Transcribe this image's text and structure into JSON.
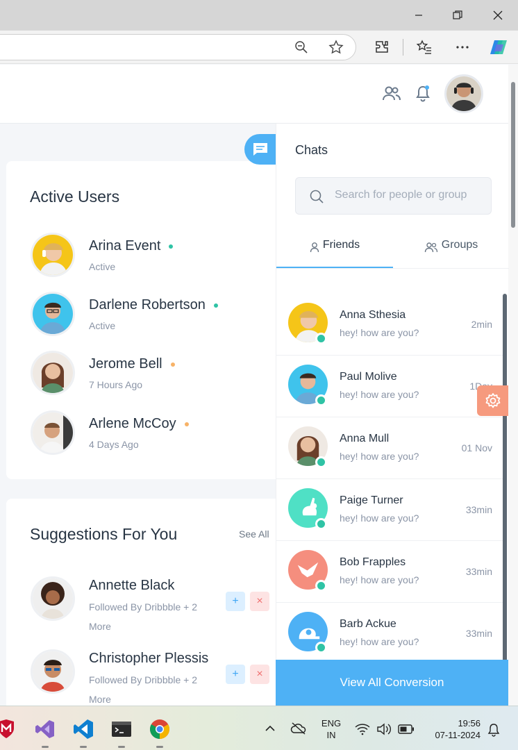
{
  "browser": {
    "window_controls": [
      "minimize",
      "restore",
      "close"
    ]
  },
  "header": {
    "icons": [
      "users-icon",
      "bell-icon"
    ]
  },
  "active_users": {
    "title": "Active Users",
    "users": [
      {
        "name": "Arina Event",
        "status": "Active",
        "dot_color": "#2fc3a5"
      },
      {
        "name": "Darlene Robertson",
        "status": "Active",
        "dot_color": "#2fc3a5"
      },
      {
        "name": "Jerome Bell",
        "status": "7 Hours Ago",
        "dot_color": "#f7b267"
      },
      {
        "name": "Arlene McCoy",
        "status": "4 Days Ago",
        "dot_color": "#f7b267"
      }
    ]
  },
  "suggestions": {
    "title": "Suggestions For You",
    "see_all": "See All",
    "items": [
      {
        "name": "Annette Black",
        "sub": "Followed By Dribbble + 2 More",
        "add": "+",
        "remove": "×"
      },
      {
        "name": "Christopher Plessis",
        "sub": "Followed By Dribbble + 2 More",
        "add": "+",
        "remove": "×"
      }
    ]
  },
  "chats": {
    "title": "Chats",
    "search_placeholder": "Search for people or group",
    "tabs": [
      {
        "label": "Friends"
      },
      {
        "label": "Groups"
      }
    ],
    "items": [
      {
        "name": "Anna Sthesia",
        "msg": "hey! how are you?",
        "time": "2min"
      },
      {
        "name": "Paul Molive",
        "msg": "hey! how are you?",
        "time": "1Day"
      },
      {
        "name": "Anna Mull",
        "msg": "hey! how are you?",
        "time": "01 Nov"
      },
      {
        "name": "Paige Turner",
        "msg": "hey! how are you?",
        "time": "33min"
      },
      {
        "name": "Bob Frapples",
        "msg": "hey! how are you?",
        "time": "33min"
      },
      {
        "name": "Barb Ackue",
        "msg": "hey! how are you?",
        "time": "33min"
      }
    ],
    "view_all": "View All Conversion"
  },
  "taskbar": {
    "lang_top": "ENG",
    "lang_bottom": "IN",
    "time": "19:56",
    "date": "07-11-2024"
  }
}
